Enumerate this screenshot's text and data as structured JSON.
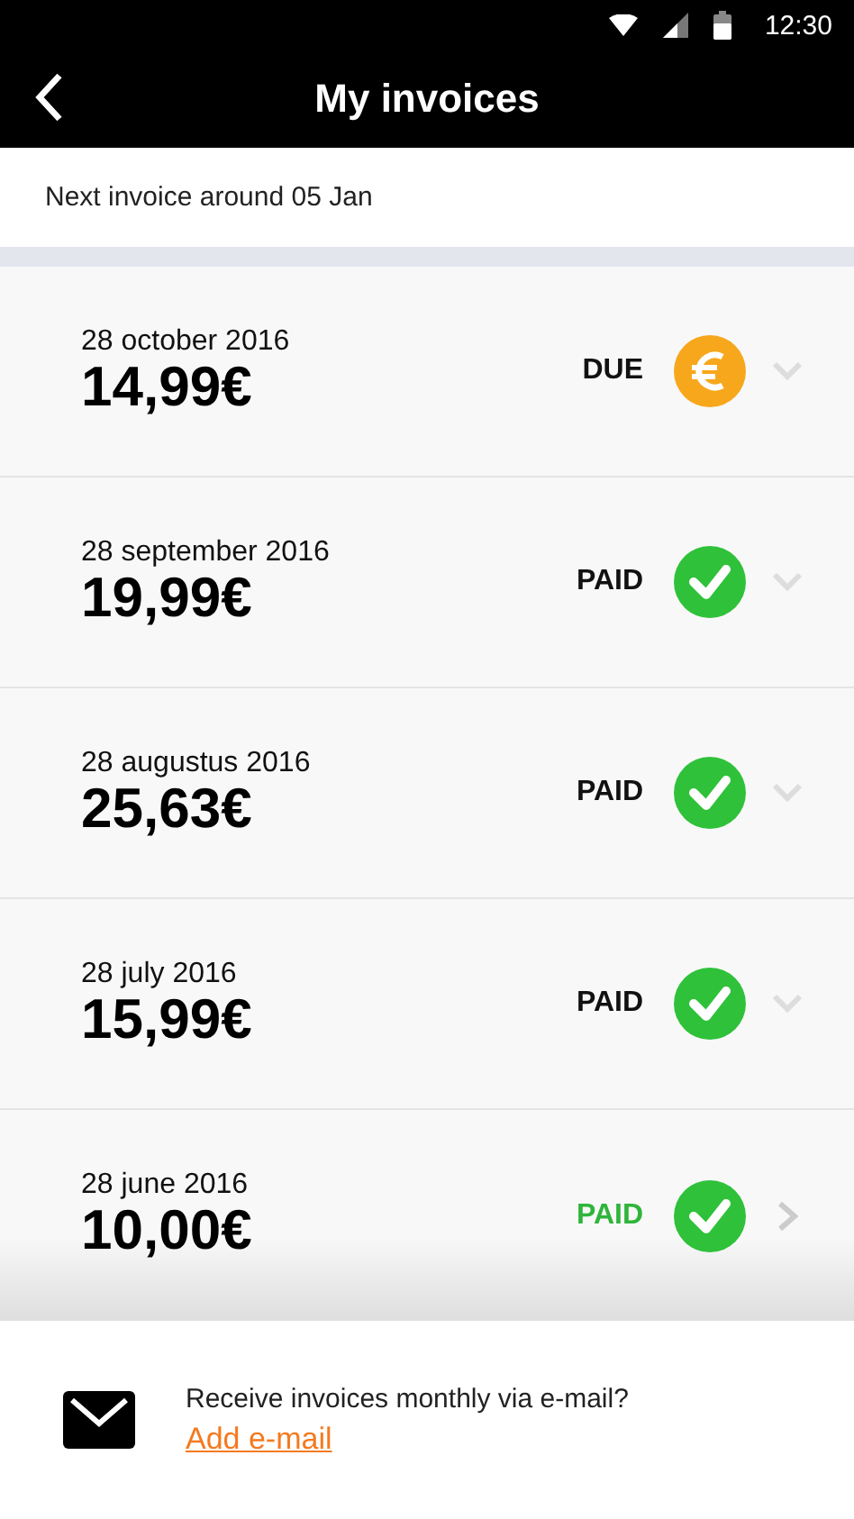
{
  "status_bar": {
    "time": "12:30"
  },
  "header": {
    "title": "My invoices"
  },
  "next_invoice": "Next invoice around 05 Jan",
  "invoices": [
    {
      "date": "28 october 2016",
      "amount": "14,99€",
      "status": "DUE",
      "kind": "due",
      "pressed": false
    },
    {
      "date": "28 september 2016",
      "amount": "19,99€",
      "status": "PAID",
      "kind": "paid",
      "pressed": false
    },
    {
      "date": "28 augustus 2016",
      "amount": "25,63€",
      "status": "PAID",
      "kind": "paid",
      "pressed": false
    },
    {
      "date": "28 july 2016",
      "amount": "15,99€",
      "status": "PAID",
      "kind": "paid",
      "pressed": false
    },
    {
      "date": "28 june 2016",
      "amount": "10,00€",
      "status": "PAID",
      "kind": "paid",
      "pressed": true
    }
  ],
  "footer": {
    "prompt": "Receive invoices monthly via e-mail?",
    "link": "Add e-mail"
  }
}
